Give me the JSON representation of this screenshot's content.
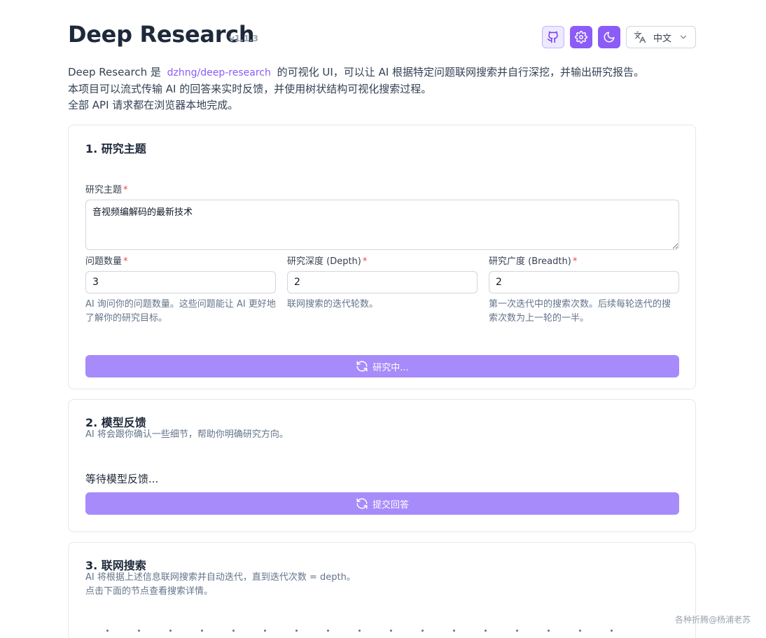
{
  "header": {
    "title": "Deep Research",
    "version": "v1.1.3",
    "language": "中文",
    "icons": [
      "github-icon",
      "gear-icon",
      "moon-icon",
      "translate-icon",
      "chevron-down-icon"
    ]
  },
  "intro": {
    "line1_prefix": "Deep Research 是",
    "link": "dzhng/deep-research",
    "line1_suffix": "的可视化 UI，可以让 AI 根据特定问题联网搜索并自行深挖，并输出研究报告。",
    "line2": "本项目可以流式传输 AI 的回答来实时反馈，并使用树状结构可视化搜索过程。",
    "line3": "全部 API 请求都在浏览器本地完成。"
  },
  "section1": {
    "title": "1. 研究主题",
    "topic_label": "研究主题",
    "topic_value": "音视频编解码的最新技术",
    "questions_label": "问题数量",
    "questions_value": "3",
    "questions_hint": "AI 询问你的问题数量。这些问题能让 AI 更好地了解你的研究目标。",
    "depth_label": "研究深度 (Depth)",
    "depth_value": "2",
    "depth_hint": "联网搜索的迭代轮数。",
    "breadth_label": "研究广度 (Breadth)",
    "breadth_value": "2",
    "breadth_hint": "第一次迭代中的搜索次数。后续每轮迭代的搜索次数为上一轮的一半。",
    "button": "研究中..."
  },
  "section2": {
    "title": "2. 模型反馈",
    "subtitle": "AI 将会跟你确认一些细节，帮助你明确研究方向。",
    "waiting": "等待模型反馈...",
    "button": "提交回答"
  },
  "section3": {
    "title": "3. 联网搜索",
    "subtitle1": "AI 将根据上述信息联网搜索并自动迭代，直到迭代次数 = depth。",
    "subtitle2": "点击下面的节点查看搜索详情。"
  },
  "watermark": "各种折腾@杨浦老苏",
  "colors": {
    "accent": "#8b5cf6",
    "button": "#a78bfa",
    "required": "#ef4444"
  }
}
